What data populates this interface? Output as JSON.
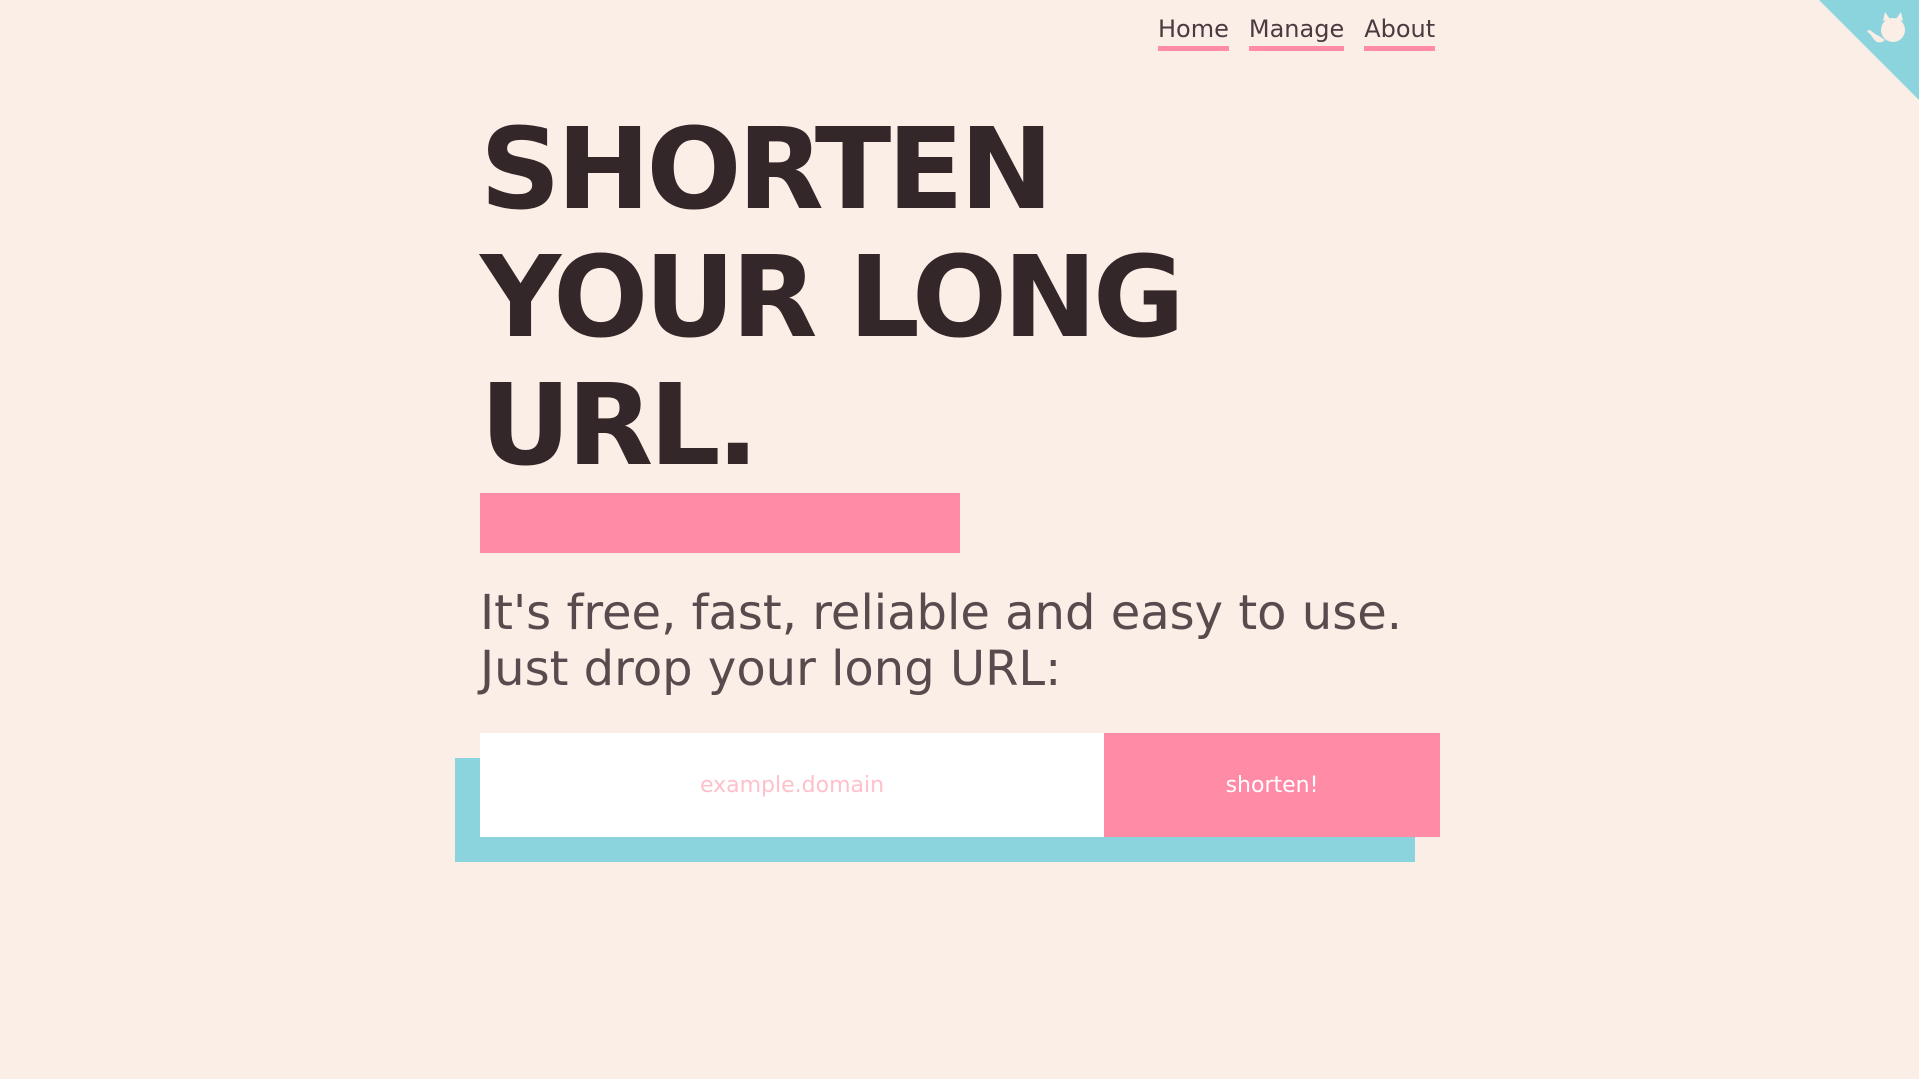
{
  "nav": {
    "items": [
      {
        "label": "Home"
      },
      {
        "label": "Manage"
      },
      {
        "label": "About"
      }
    ]
  },
  "corner": {
    "icon": "github-octocat-icon",
    "color": "#8bd3dd"
  },
  "hero": {
    "headline_lines": [
      "SHORTEN",
      "YOUR LONG",
      "URL."
    ],
    "subtext_lines": [
      "It's free, fast, reliable and easy to use.",
      "Just drop your long URL:"
    ]
  },
  "form": {
    "input_placeholder": "example.domain",
    "input_value": "",
    "button_label": "shorten!"
  },
  "colors": {
    "background": "#fbeee6",
    "accent_pink": "#ff8ba7",
    "accent_teal": "#8bd3dd",
    "headline": "#33272a",
    "subtext": "#594a4e"
  }
}
